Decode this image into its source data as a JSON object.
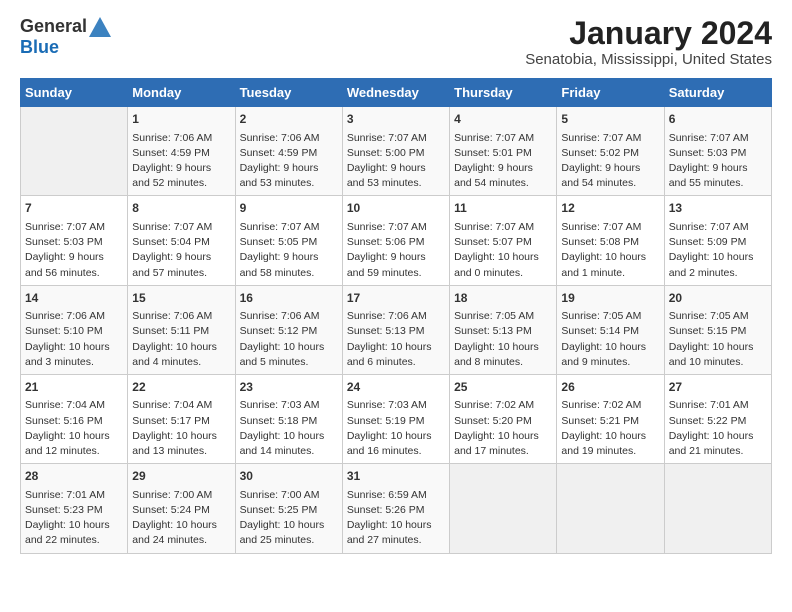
{
  "logo": {
    "general": "General",
    "blue": "Blue"
  },
  "title": "January 2024",
  "subtitle": "Senatobia, Mississippi, United States",
  "days_of_week": [
    "Sunday",
    "Monday",
    "Tuesday",
    "Wednesday",
    "Thursday",
    "Friday",
    "Saturday"
  ],
  "weeks": [
    [
      {
        "day": "",
        "content": ""
      },
      {
        "day": "1",
        "content": "Sunrise: 7:06 AM\nSunset: 4:59 PM\nDaylight: 9 hours\nand 52 minutes."
      },
      {
        "day": "2",
        "content": "Sunrise: 7:06 AM\nSunset: 4:59 PM\nDaylight: 9 hours\nand 53 minutes."
      },
      {
        "day": "3",
        "content": "Sunrise: 7:07 AM\nSunset: 5:00 PM\nDaylight: 9 hours\nand 53 minutes."
      },
      {
        "day": "4",
        "content": "Sunrise: 7:07 AM\nSunset: 5:01 PM\nDaylight: 9 hours\nand 54 minutes."
      },
      {
        "day": "5",
        "content": "Sunrise: 7:07 AM\nSunset: 5:02 PM\nDaylight: 9 hours\nand 54 minutes."
      },
      {
        "day": "6",
        "content": "Sunrise: 7:07 AM\nSunset: 5:03 PM\nDaylight: 9 hours\nand 55 minutes."
      }
    ],
    [
      {
        "day": "7",
        "content": "Sunrise: 7:07 AM\nSunset: 5:03 PM\nDaylight: 9 hours\nand 56 minutes."
      },
      {
        "day": "8",
        "content": "Sunrise: 7:07 AM\nSunset: 5:04 PM\nDaylight: 9 hours\nand 57 minutes."
      },
      {
        "day": "9",
        "content": "Sunrise: 7:07 AM\nSunset: 5:05 PM\nDaylight: 9 hours\nand 58 minutes."
      },
      {
        "day": "10",
        "content": "Sunrise: 7:07 AM\nSunset: 5:06 PM\nDaylight: 9 hours\nand 59 minutes."
      },
      {
        "day": "11",
        "content": "Sunrise: 7:07 AM\nSunset: 5:07 PM\nDaylight: 10 hours\nand 0 minutes."
      },
      {
        "day": "12",
        "content": "Sunrise: 7:07 AM\nSunset: 5:08 PM\nDaylight: 10 hours\nand 1 minute."
      },
      {
        "day": "13",
        "content": "Sunrise: 7:07 AM\nSunset: 5:09 PM\nDaylight: 10 hours\nand 2 minutes."
      }
    ],
    [
      {
        "day": "14",
        "content": "Sunrise: 7:06 AM\nSunset: 5:10 PM\nDaylight: 10 hours\nand 3 minutes."
      },
      {
        "day": "15",
        "content": "Sunrise: 7:06 AM\nSunset: 5:11 PM\nDaylight: 10 hours\nand 4 minutes."
      },
      {
        "day": "16",
        "content": "Sunrise: 7:06 AM\nSunset: 5:12 PM\nDaylight: 10 hours\nand 5 minutes."
      },
      {
        "day": "17",
        "content": "Sunrise: 7:06 AM\nSunset: 5:13 PM\nDaylight: 10 hours\nand 6 minutes."
      },
      {
        "day": "18",
        "content": "Sunrise: 7:05 AM\nSunset: 5:13 PM\nDaylight: 10 hours\nand 8 minutes."
      },
      {
        "day": "19",
        "content": "Sunrise: 7:05 AM\nSunset: 5:14 PM\nDaylight: 10 hours\nand 9 minutes."
      },
      {
        "day": "20",
        "content": "Sunrise: 7:05 AM\nSunset: 5:15 PM\nDaylight: 10 hours\nand 10 minutes."
      }
    ],
    [
      {
        "day": "21",
        "content": "Sunrise: 7:04 AM\nSunset: 5:16 PM\nDaylight: 10 hours\nand 12 minutes."
      },
      {
        "day": "22",
        "content": "Sunrise: 7:04 AM\nSunset: 5:17 PM\nDaylight: 10 hours\nand 13 minutes."
      },
      {
        "day": "23",
        "content": "Sunrise: 7:03 AM\nSunset: 5:18 PM\nDaylight: 10 hours\nand 14 minutes."
      },
      {
        "day": "24",
        "content": "Sunrise: 7:03 AM\nSunset: 5:19 PM\nDaylight: 10 hours\nand 16 minutes."
      },
      {
        "day": "25",
        "content": "Sunrise: 7:02 AM\nSunset: 5:20 PM\nDaylight: 10 hours\nand 17 minutes."
      },
      {
        "day": "26",
        "content": "Sunrise: 7:02 AM\nSunset: 5:21 PM\nDaylight: 10 hours\nand 19 minutes."
      },
      {
        "day": "27",
        "content": "Sunrise: 7:01 AM\nSunset: 5:22 PM\nDaylight: 10 hours\nand 21 minutes."
      }
    ],
    [
      {
        "day": "28",
        "content": "Sunrise: 7:01 AM\nSunset: 5:23 PM\nDaylight: 10 hours\nand 22 minutes."
      },
      {
        "day": "29",
        "content": "Sunrise: 7:00 AM\nSunset: 5:24 PM\nDaylight: 10 hours\nand 24 minutes."
      },
      {
        "day": "30",
        "content": "Sunrise: 7:00 AM\nSunset: 5:25 PM\nDaylight: 10 hours\nand 25 minutes."
      },
      {
        "day": "31",
        "content": "Sunrise: 6:59 AM\nSunset: 5:26 PM\nDaylight: 10 hours\nand 27 minutes."
      },
      {
        "day": "",
        "content": ""
      },
      {
        "day": "",
        "content": ""
      },
      {
        "day": "",
        "content": ""
      }
    ]
  ]
}
